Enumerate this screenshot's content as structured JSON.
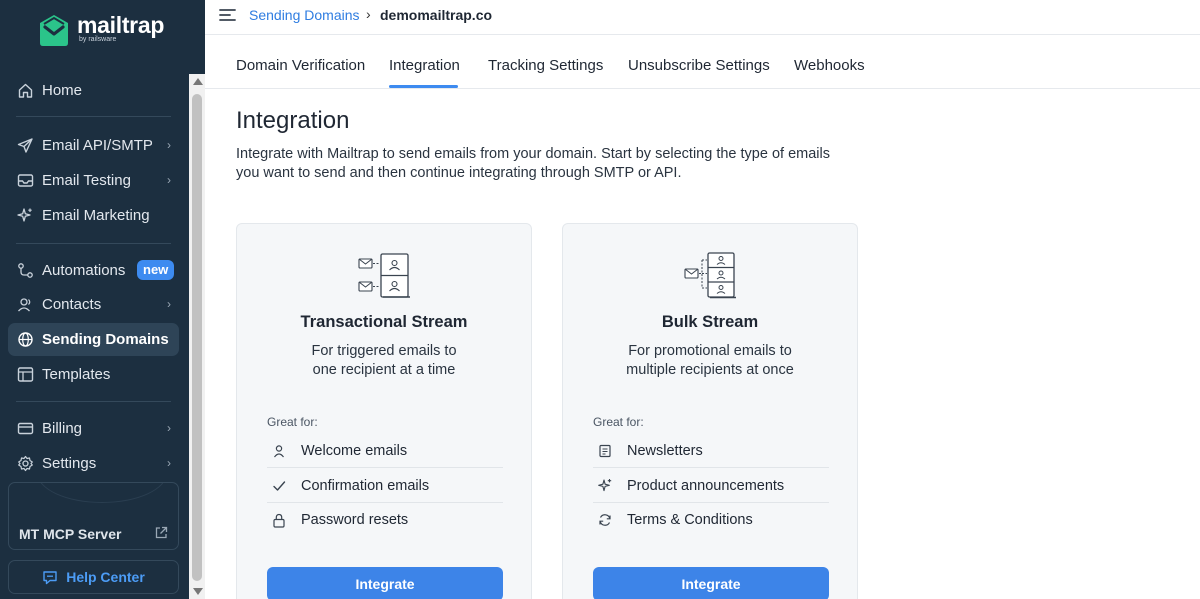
{
  "brand": {
    "name": "mailtrap",
    "sub": "by railsware",
    "accent": "#3d8bf0",
    "sidebar_bg": "#1c2f40"
  },
  "sidebar": {
    "items": [
      {
        "label": "Home",
        "icon": "home-icon"
      },
      {
        "label": "Email API/SMTP",
        "icon": "send-icon",
        "chevron": "›"
      },
      {
        "label": "Email Testing",
        "icon": "inbox-icon",
        "chevron": "›"
      },
      {
        "label": "Email Marketing",
        "icon": "sparkle-icon"
      },
      {
        "label": "Automations",
        "icon": "automation-icon",
        "badge": "new"
      },
      {
        "label": "Contacts",
        "icon": "contacts-icon",
        "chevron": "›"
      },
      {
        "label": "Sending Domains",
        "icon": "globe-icon",
        "active": true
      },
      {
        "label": "Templates",
        "icon": "templates-icon"
      },
      {
        "label": "Billing",
        "icon": "billing-icon",
        "chevron": "›"
      },
      {
        "label": "Settings",
        "icon": "settings-icon",
        "chevron": "›"
      }
    ],
    "mcp_label": "MT MCP Server",
    "help_label": "Help Center"
  },
  "header": {
    "breadcrumb_link": "Sending Domains",
    "breadcrumb_sep": "›",
    "breadcrumb_current": "demomailtrap.co"
  },
  "tabs": [
    {
      "label": "Domain Verification"
    },
    {
      "label": "Integration",
      "active": true
    },
    {
      "label": "Tracking Settings"
    },
    {
      "label": "Unsubscribe Settings"
    },
    {
      "label": "Webhooks"
    }
  ],
  "main": {
    "title": "Integration",
    "intro": "Integrate with Mailtrap to send emails from your domain. Start by selecting the type of emails you want to send and then continue integrating through SMTP or API."
  },
  "cards": [
    {
      "title": "Transactional Stream",
      "desc_line1": "For triggered emails to",
      "desc_line2": "one recipient at a time",
      "great_for": "Great for:",
      "features": [
        {
          "label": "Welcome emails",
          "icon": "user-icon"
        },
        {
          "label": "Confirmation emails",
          "icon": "check-icon"
        },
        {
          "label": "Password resets",
          "icon": "lock-icon"
        }
      ],
      "button": "Integrate"
    },
    {
      "title": "Bulk Stream",
      "desc_line1": "For promotional emails to",
      "desc_line2": "multiple recipients at once",
      "great_for": "Great for:",
      "features": [
        {
          "label": "Newsletters",
          "icon": "newsletter-icon"
        },
        {
          "label": "Product announcements",
          "icon": "sparkle-icon"
        },
        {
          "label": "Terms & Conditions",
          "icon": "refresh-icon"
        }
      ],
      "button": "Integrate"
    }
  ]
}
